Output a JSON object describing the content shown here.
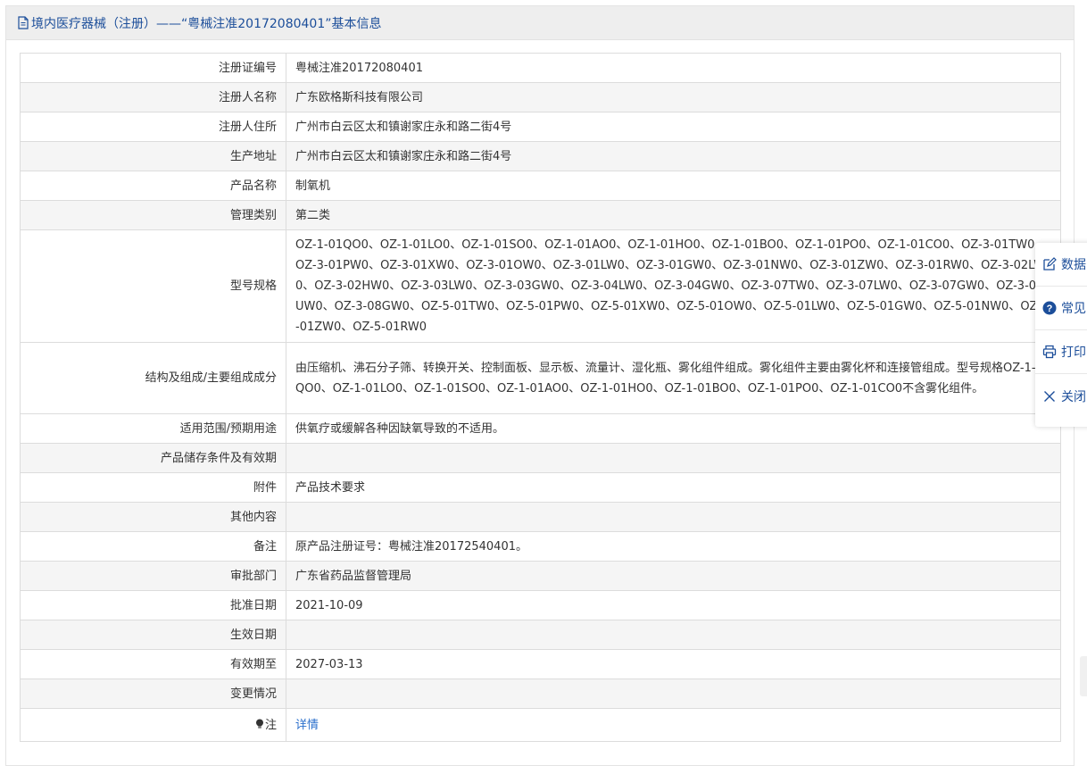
{
  "header": {
    "title": "境内医疗器械（注册）——“粤械注准20172080401”基本信息"
  },
  "rows": [
    {
      "label": "注册证编号",
      "value": "粤械注准20172080401"
    },
    {
      "label": "注册人名称",
      "value": "广东欧格斯科技有限公司"
    },
    {
      "label": "注册人住所",
      "value": "广州市白云区太和镇谢家庄永和路二街4号"
    },
    {
      "label": "生产地址",
      "value": "广州市白云区太和镇谢家庄永和路二街4号"
    },
    {
      "label": "产品名称",
      "value": "制氧机"
    },
    {
      "label": "管理类别",
      "value": "第二类"
    },
    {
      "label": "型号规格",
      "value": "OZ-1-01QO0、OZ-1-01LO0、OZ-1-01SO0、OZ-1-01AO0、OZ-1-01HO0、OZ-1-01BO0、OZ-1-01PO0、OZ-1-01CO0、OZ-3-01TW0、OZ-3-01PW0、OZ-3-01XW0、OZ-3-01OW0、OZ-3-01LW0、OZ-3-01GW0、OZ-3-01NW0、OZ-3-01ZW0、OZ-3-01RW0、OZ-3-02LW0、OZ-3-02HW0、OZ-3-03LW0、OZ-3-03GW0、OZ-3-04LW0、OZ-3-04GW0、OZ-3-07TW0、OZ-3-07LW0、OZ-3-07GW0、OZ-3-08UW0、OZ-3-08GW0、OZ-5-01TW0、OZ-5-01PW0、OZ-5-01XW0、OZ-5-01OW0、OZ-5-01LW0、OZ-5-01GW0、OZ-5-01NW0、OZ-5-01ZW0、OZ-5-01RW0"
    },
    {
      "label": "结构及组成/主要组成成分",
      "value": "由压缩机、沸石分子筛、转换开关、控制面板、显示板、流量计、湿化瓶、雾化组件组成。雾化组件主要由雾化杯和连接管组成。型号规格OZ-1-01QO0、OZ-1-01LO0、OZ-1-01SO0、OZ-1-01AO0、OZ-1-01HO0、OZ-1-01BO0、OZ-1-01PO0、OZ-1-01CO0不含雾化组件。"
    },
    {
      "label": "适用范围/预期用途",
      "value": "供氧疗或缓解各种因缺氧导致的不适用。"
    },
    {
      "label": "产品储存条件及有效期",
      "value": ""
    },
    {
      "label": "附件",
      "value": "产品技术要求"
    },
    {
      "label": "其他内容",
      "value": ""
    },
    {
      "label": "备注",
      "value": "原产品注册证号：粤械注准20172540401。"
    },
    {
      "label": "审批部门",
      "value": "广东省药品监督管理局"
    },
    {
      "label": "批准日期",
      "value": "2021-10-09"
    },
    {
      "label": "生效日期",
      "value": ""
    },
    {
      "label": "有效期至",
      "value": "2027-03-13"
    },
    {
      "label": "变更情况",
      "value": ""
    },
    {
      "label": "注",
      "value": "详情"
    }
  ],
  "float_menu": {
    "items": [
      {
        "label": "数据",
        "icon": "edit-icon"
      },
      {
        "label": "常见",
        "icon": "question-icon"
      },
      {
        "label": "打印",
        "icon": "printer-icon"
      },
      {
        "label": "关闭",
        "icon": "close-icon"
      }
    ]
  },
  "colors": {
    "accent": "#1c4e9a",
    "link": "#2a6fcc",
    "header_bg": "#eeeeee",
    "row_alt_bg": "#f5f5f5",
    "border": "#dcdcdc"
  }
}
